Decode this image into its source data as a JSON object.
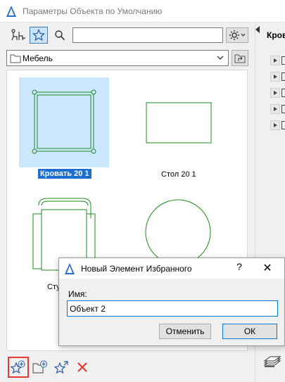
{
  "window": {
    "title": "Параметры Объекта по Умолчанию"
  },
  "toolbar": {
    "search": {
      "value": ""
    }
  },
  "folder": {
    "selected": "Мебель"
  },
  "grid": {
    "items": [
      {
        "label": "Кровать 20 1",
        "selected": true
      },
      {
        "label": "Стол 20 1",
        "selected": false
      },
      {
        "label": "Сту",
        "selected": false
      },
      {
        "label": "",
        "selected": false
      }
    ]
  },
  "side_panel": {
    "title": "Кров"
  },
  "dialog": {
    "title": "Новый Элемент Избранного",
    "help_label": "?",
    "close_label": "✕",
    "name_label": "Имя:",
    "name_value": "Объект 2",
    "cancel_label": "Отменить",
    "ok_label": "ОК"
  },
  "colors": {
    "accent": "#0078d7",
    "selection": "#cce8ff",
    "drawing": "#1e8a1e",
    "highlight_border": "#e53935",
    "delete": "#e53935"
  }
}
